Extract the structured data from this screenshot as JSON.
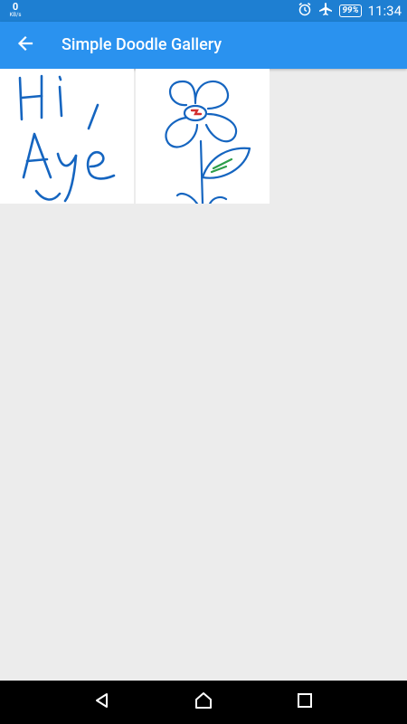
{
  "status_bar": {
    "net_speed_value": "0",
    "net_speed_unit": "KB/s",
    "battery": "99%",
    "time": "11:34",
    "icons": [
      "alarm-icon",
      "airplane-icon",
      "battery-icon"
    ]
  },
  "app_bar": {
    "title": "Simple Doodle Gallery",
    "back_icon": "arrow-back-icon"
  },
  "gallery": {
    "items": [
      {
        "name": "doodle-hi-aye",
        "text": "Hi, Aye"
      },
      {
        "name": "doodle-flower"
      }
    ]
  },
  "nav_bar": {
    "icons": [
      "back-triangle-icon",
      "home-circle-icon",
      "recents-square-icon"
    ]
  },
  "colors": {
    "status_bar": "#1e7fd2",
    "app_bar": "#2a92ef",
    "background": "#ececec",
    "ink_blue": "#1565c0",
    "ink_red": "#d32f2f",
    "ink_green": "#2e9e4a"
  }
}
